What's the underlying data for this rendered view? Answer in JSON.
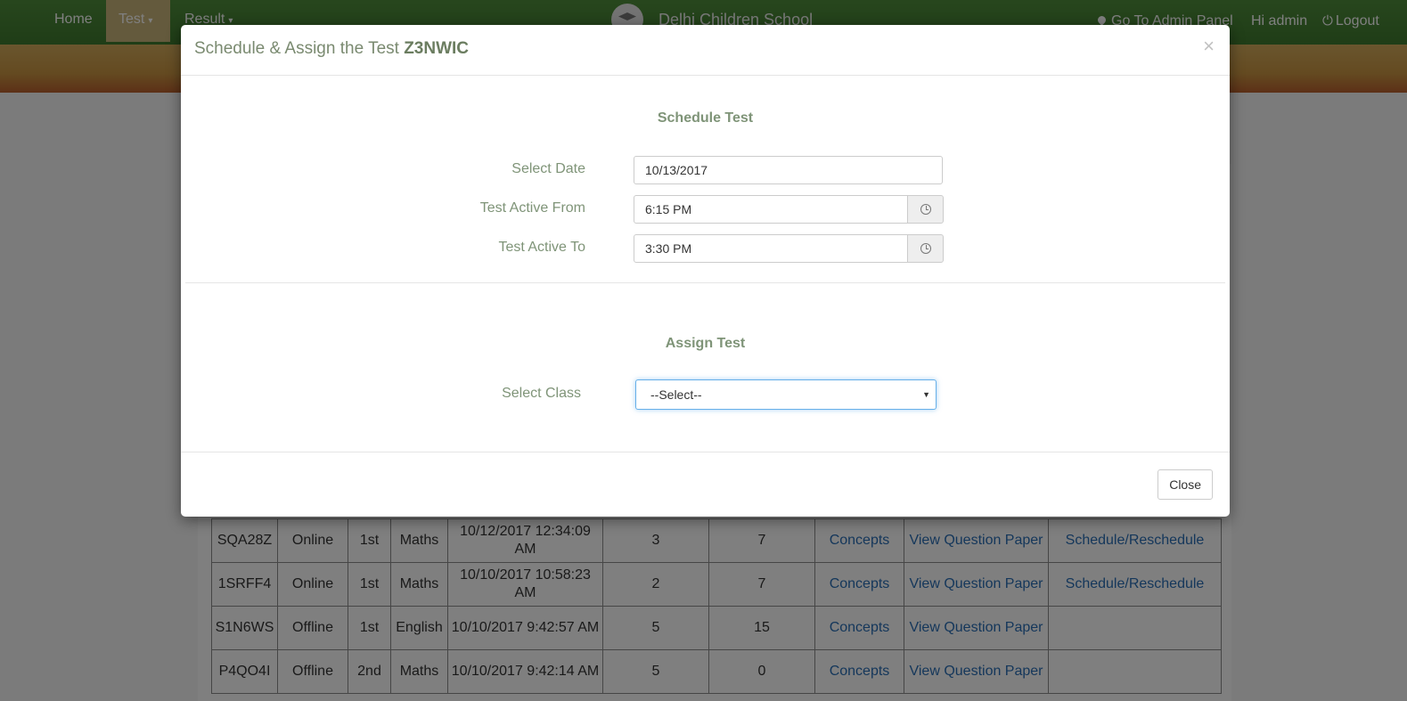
{
  "nav": {
    "home": "Home",
    "test": "Test",
    "result": "Result",
    "brand": "Delhi Children School",
    "admin_panel": "Go To Admin Panel",
    "greeting": "Hi admin",
    "logout": "Logout"
  },
  "table": {
    "rows": [
      {
        "code": "SQA28Z",
        "mode": "Online",
        "class": "1st",
        "subject": "Maths",
        "date_line1": "10/12/2017 12:34:09",
        "date_line2": "AM",
        "n1": "3",
        "n2": "7",
        "concepts": "Concepts",
        "view": "View Question Paper",
        "schedule": "Schedule/Reschedule"
      },
      {
        "code": "1SRFF4",
        "mode": "Online",
        "class": "1st",
        "subject": "Maths",
        "date_line1": "10/10/2017 10:58:23",
        "date_line2": "AM",
        "n1": "2",
        "n2": "7",
        "concepts": "Concepts",
        "view": "View Question Paper",
        "schedule": "Schedule/Reschedule"
      },
      {
        "code": "S1N6WS",
        "mode": "Offline",
        "class": "1st",
        "subject": "English",
        "date_line1": "10/10/2017 9:42:57 AM",
        "date_line2": "",
        "n1": "5",
        "n2": "15",
        "concepts": "Concepts",
        "view": "View Question Paper",
        "schedule": ""
      },
      {
        "code": "P4QO4I",
        "mode": "Offline",
        "class": "2nd",
        "subject": "Maths",
        "date_line1": "10/10/2017 9:42:14 AM",
        "date_line2": "",
        "n1": "5",
        "n2": "0",
        "concepts": "Concepts",
        "view": "View Question Paper",
        "schedule": ""
      }
    ]
  },
  "modal": {
    "title_prefix": "Schedule & Assign the Test",
    "test_code": "Z3NWIC",
    "close_symbol": "×",
    "schedule_heading": "Schedule Test",
    "date_label": "Select Date",
    "date_value": "10/13/2017",
    "from_label": "Test Active From",
    "from_value": "6:15 PM",
    "to_label": "Test Active To",
    "to_value": "3:30 PM",
    "assign_heading": "Assign Test",
    "class_label": "Select Class",
    "class_selected": "--Select--",
    "close_button": "Close"
  }
}
